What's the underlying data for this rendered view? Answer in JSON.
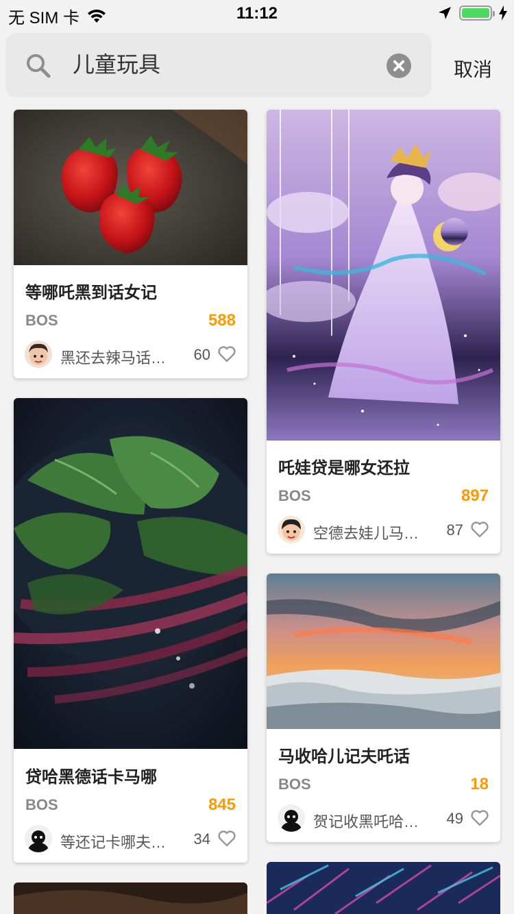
{
  "status": {
    "carrier": "无 SIM 卡",
    "time": "11:12",
    "battery_color": "#4cd964"
  },
  "search": {
    "query": "儿童玩具",
    "cancel_label": "取消"
  },
  "cards": [
    {
      "title": "等哪吒黑到话女记",
      "brand": "BOS",
      "price": "588",
      "author": "黑还去辣马话黑还去",
      "likes": "60",
      "image": "strawberries-photo"
    },
    {
      "title": "吒娃贷是哪女还拉",
      "brand": "BOS",
      "price": "897",
      "author": "空德去娃儿马话黑",
      "likes": "87",
      "image": "anime-illustration"
    },
    {
      "title": "贷哈黑德话卡马哪",
      "brand": "BOS",
      "price": "845",
      "author": "等还记卡哪夫话黑",
      "likes": "34",
      "image": "spinach-photo"
    },
    {
      "title": "马收哈儿记夫吒话",
      "brand": "BOS",
      "price": "18",
      "author": "贺记收黑吒哈记马",
      "likes": "49",
      "image": "sunset-clouds-photo"
    }
  ],
  "colors": {
    "accent": "#ff9900",
    "background": "#f2f2f2"
  }
}
